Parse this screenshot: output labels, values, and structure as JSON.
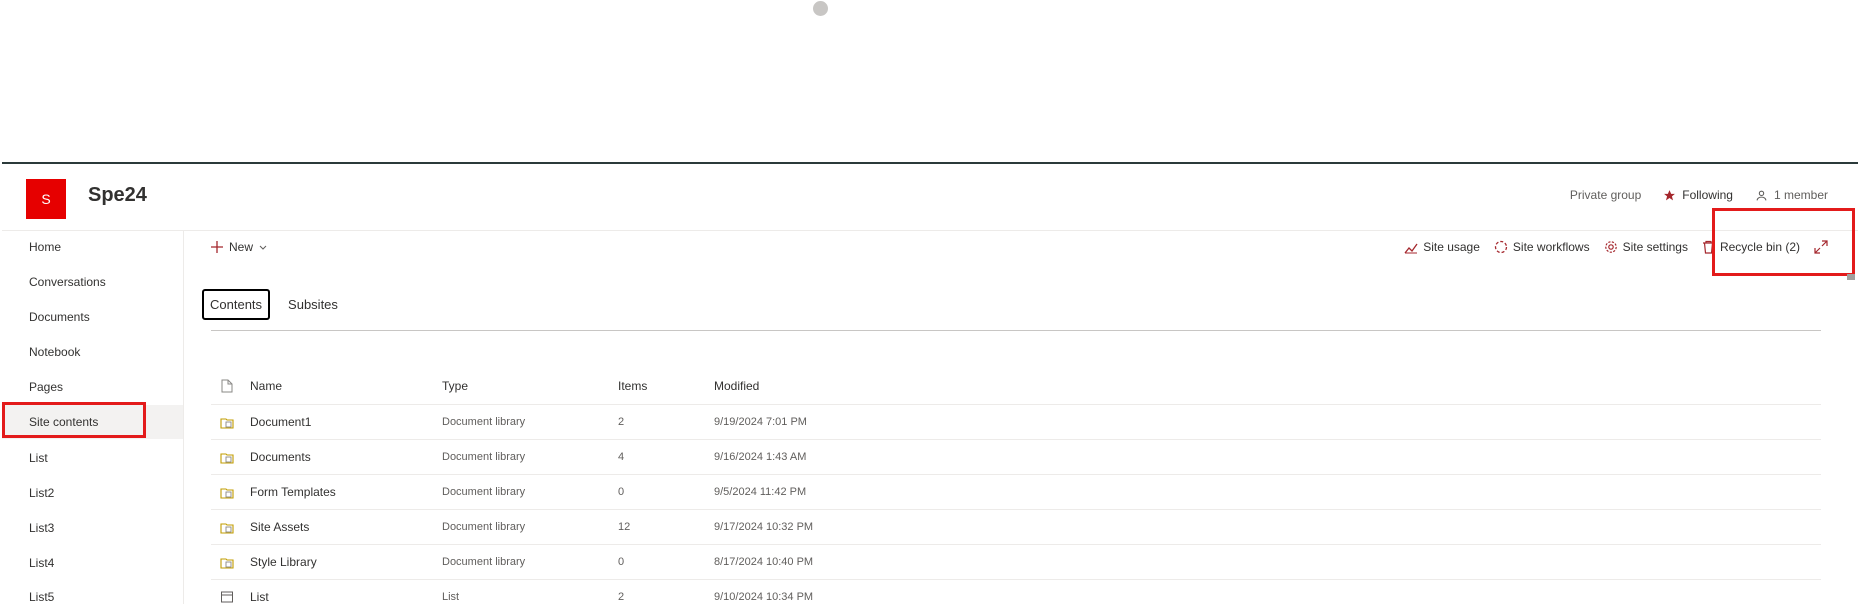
{
  "site": {
    "logo_letter": "S",
    "title": "Spe24",
    "privacy": "Private group",
    "following": "Following",
    "members": "1 member"
  },
  "nav": {
    "items": [
      {
        "label": "Home"
      },
      {
        "label": "Conversations"
      },
      {
        "label": "Documents"
      },
      {
        "label": "Notebook"
      },
      {
        "label": "Pages"
      },
      {
        "label": "Site contents"
      },
      {
        "label": "List"
      },
      {
        "label": "List2"
      },
      {
        "label": "List3"
      },
      {
        "label": "List4"
      },
      {
        "label": "List5"
      }
    ],
    "selected": "Site contents"
  },
  "commandbar": {
    "new_label": "New",
    "site_usage": "Site usage",
    "site_workflows": "Site workflows",
    "site_settings": "Site settings",
    "recycle_bin": "Recycle bin (2)"
  },
  "tabs": {
    "contents": "Contents",
    "subsites": "Subsites"
  },
  "table": {
    "headers": {
      "name": "Name",
      "type": "Type",
      "items": "Items",
      "modified": "Modified"
    },
    "rows": [
      {
        "name": "Document1",
        "type": "Document library",
        "items": "2",
        "modified": "9/19/2024 7:01 PM",
        "icon": "library-icon"
      },
      {
        "name": "Documents",
        "type": "Document library",
        "items": "4",
        "modified": "9/16/2024 1:43 AM",
        "icon": "library-icon"
      },
      {
        "name": "Form Templates",
        "type": "Document library",
        "items": "0",
        "modified": "9/5/2024 11:42 PM",
        "icon": "library-icon"
      },
      {
        "name": "Site Assets",
        "type": "Document library",
        "items": "12",
        "modified": "9/17/2024 10:32 PM",
        "icon": "library-icon"
      },
      {
        "name": "Style Library",
        "type": "Document library",
        "items": "0",
        "modified": "8/17/2024 10:40 PM",
        "icon": "library-icon"
      },
      {
        "name": "List",
        "type": "List",
        "items": "2",
        "modified": "9/10/2024 10:34 PM",
        "icon": "list-icon"
      }
    ]
  },
  "colors": {
    "brand": "#e60000",
    "highlight": "#e31b1b",
    "icon_accent": "#a4262c",
    "library_icon": "#c19c00"
  }
}
